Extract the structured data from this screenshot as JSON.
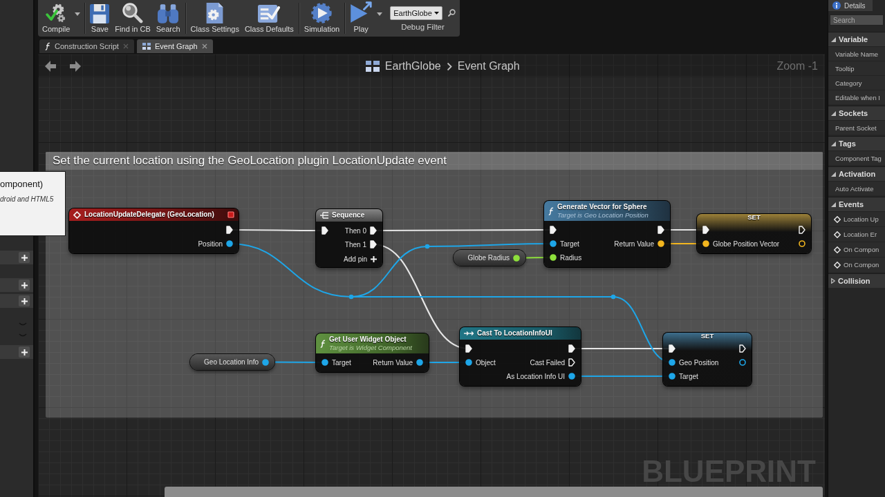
{
  "toolbar": {
    "buttons": [
      {
        "label": "Compile",
        "dropdown": true
      },
      {
        "label": "Save",
        "dropdown": false
      },
      {
        "label": "Find in CB",
        "dropdown": false
      },
      {
        "label": "Search",
        "dropdown": false
      },
      {
        "label": "Class Settings",
        "dropdown": false
      },
      {
        "label": "Class Defaults",
        "dropdown": false
      },
      {
        "label": "Simulation",
        "dropdown": false
      },
      {
        "label": "Play",
        "dropdown": true
      }
    ],
    "debug_filter": {
      "value": "EarthGlobe",
      "label": "Debug Filter"
    }
  },
  "tabs": [
    {
      "label": "Construction Script",
      "selected": false
    },
    {
      "label": "Event Graph",
      "selected": true
    }
  ],
  "left_panel": {
    "rows": [
      {
        "kind": "add"
      },
      {
        "kind": "add"
      },
      {
        "kind": "add"
      },
      {
        "kind": "collapsed"
      },
      {
        "kind": "collapsed"
      },
      {
        "kind": "add"
      }
    ],
    "tooltip": {
      "title": "omponent)",
      "description": "droid and HTML5"
    }
  },
  "graph": {
    "breadcrumb": [
      "EarthGlobe",
      "Event Graph"
    ],
    "zoom": "Zoom -1",
    "comments": [
      {
        "kind": "comment",
        "text": "Set the current location using the GeoLocation plugin LocationUpdate event"
      },
      {
        "kind": "comment"
      }
    ],
    "nodes": [
      {
        "kind": "event",
        "title": "LocationUpdateDelegate (GeoLocation)",
        "outputs": [
          {
            "kind": "exec",
            "connected": true
          },
          {
            "kind": "object",
            "label": "Position",
            "connected": true
          }
        ]
      },
      {
        "kind": "sequence",
        "title": "Sequence",
        "inputs": [
          {
            "kind": "exec",
            "connected": true
          }
        ],
        "outputs": [
          {
            "kind": "exec",
            "label": "Then 0",
            "connected": true
          },
          {
            "kind": "exec",
            "label": "Then 1",
            "connected": true
          }
        ],
        "add_pin": "Add pin"
      },
      {
        "kind": "variable_get",
        "title": "Globe Radius",
        "outputs": [
          {
            "kind": "float",
            "connected": true
          }
        ]
      },
      {
        "kind": "function",
        "title": "Generate Vector for Sphere",
        "subtitle": "Target is Geo Location Position",
        "inputs": [
          {
            "kind": "exec",
            "connected": true
          },
          {
            "kind": "object",
            "label": "Target",
            "connected": true
          },
          {
            "kind": "float",
            "label": "Radius",
            "connected": true
          }
        ],
        "outputs": [
          {
            "kind": "exec",
            "connected": true
          },
          {
            "kind": "vector",
            "label": "Return Value",
            "connected": true
          }
        ]
      },
      {
        "kind": "set",
        "title": "SET",
        "inputs": [
          {
            "kind": "exec",
            "connected": true
          },
          {
            "kind": "vector",
            "label": "Globe Position Vector",
            "connected": true
          }
        ],
        "outputs": [
          {
            "kind": "exec",
            "connected": false
          },
          {
            "kind": "vector",
            "connected": false
          }
        ]
      },
      {
        "kind": "variable_get",
        "title": "Geo Location Info",
        "outputs": [
          {
            "kind": "object",
            "connected": true
          }
        ]
      },
      {
        "kind": "pure_function",
        "title": "Get User Widget Object",
        "subtitle": "Target is Widget Component",
        "inputs": [
          {
            "kind": "object",
            "label": "Target",
            "connected": true
          }
        ],
        "outputs": [
          {
            "kind": "object",
            "label": "Return Value",
            "connected": true
          }
        ]
      },
      {
        "kind": "cast",
        "title": "Cast To LocationInfoUI",
        "inputs": [
          {
            "kind": "exec",
            "connected": true
          },
          {
            "kind": "object",
            "label": "Object",
            "connected": true
          }
        ],
        "outputs": [
          {
            "kind": "exec",
            "connected": true
          },
          {
            "kind": "exec",
            "label": "Cast Failed",
            "connected": false
          },
          {
            "kind": "object",
            "label": "As Location Info UI",
            "connected": true
          }
        ]
      },
      {
        "kind": "set",
        "title": "SET",
        "inputs": [
          {
            "kind": "exec",
            "connected": true
          },
          {
            "kind": "object",
            "label": "Geo Position",
            "connected": true
          },
          {
            "kind": "object",
            "label": "Target",
            "connected": true
          }
        ],
        "outputs": [
          {
            "kind": "exec",
            "connected": false
          },
          {
            "kind": "object",
            "connected": false
          }
        ]
      }
    ],
    "reroutes": [
      {
        "kind": "object"
      },
      {
        "kind": "object"
      },
      {
        "kind": "object"
      }
    ],
    "watermark": "BLUEPRINT"
  },
  "details": {
    "title": "Details",
    "search": {
      "placeholder": "Search"
    },
    "sections": [
      {
        "title": "Variable",
        "expanded": true,
        "items": [
          {
            "label": "Variable Name",
            "kind": "property"
          },
          {
            "label": "Tooltip",
            "kind": "property"
          },
          {
            "label": "Category",
            "kind": "property"
          },
          {
            "label": "Editable when I",
            "kind": "property"
          }
        ]
      },
      {
        "title": "Sockets",
        "expanded": true,
        "items": [
          {
            "label": "Parent Socket",
            "kind": "property"
          }
        ]
      },
      {
        "title": "Tags",
        "expanded": true,
        "items": [
          {
            "label": "Component Tag",
            "kind": "property"
          }
        ]
      },
      {
        "title": "Activation",
        "expanded": true,
        "items": [
          {
            "label": "Auto Activate",
            "kind": "property"
          }
        ]
      },
      {
        "title": "Events",
        "expanded": true,
        "items": [
          {
            "label": "Location Up",
            "kind": "event"
          },
          {
            "label": "Location Er",
            "kind": "event"
          },
          {
            "label": "On Compon",
            "kind": "event"
          },
          {
            "label": "On Compon",
            "kind": "event"
          }
        ]
      },
      {
        "title": "Collision",
        "expanded": false
      }
    ]
  }
}
